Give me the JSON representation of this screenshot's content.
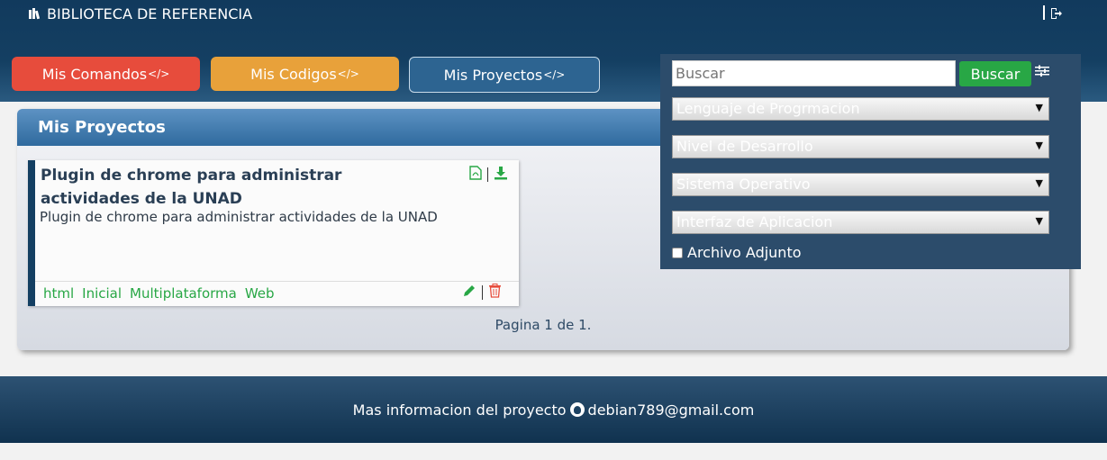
{
  "header": {
    "brand": "BIBLIOTECA DE REFERENCIA",
    "brand_icon": "library-icon",
    "logout_icon": "sign-out-icon"
  },
  "nav": {
    "commands": "Mis Comandos",
    "codes": "Mis Codigos",
    "projects": "Mis Proyectos",
    "code_glyph": "</>"
  },
  "panel": {
    "title": "Mis Proyectos"
  },
  "card": {
    "title": "Plugin de chrome para administrar actividades de la UNAD",
    "description": "Plugin de chrome para administrar actividades de la UNAD",
    "tags": [
      "html",
      "Inicial",
      "Multiplataforma",
      "Web"
    ],
    "icons": [
      "file-pdf-icon",
      "download-icon",
      "edit-icon",
      "trash-icon"
    ]
  },
  "pagination": "Pagina 1 de 1.",
  "search": {
    "placeholder": "Buscar",
    "button": "Buscar",
    "filter_icon": "sliders-icon",
    "language": "Lenguaje de Progrmacion",
    "level": "Nivel de Desarrollo",
    "os": "Sistema Operativo",
    "interface": "Interfaz de Aplicacion",
    "attachment": "Archivo Adjunto"
  },
  "footer": {
    "text": "Mas informacion del proyecto",
    "email": "debian789@gmail.com",
    "icon": "github-icon"
  },
  "colors": {
    "header": "#143f62",
    "commands": "#e74c3c",
    "codes": "#e8a13a",
    "projects": "#2d6491",
    "green": "#28a745",
    "red": "#e74c3c"
  }
}
